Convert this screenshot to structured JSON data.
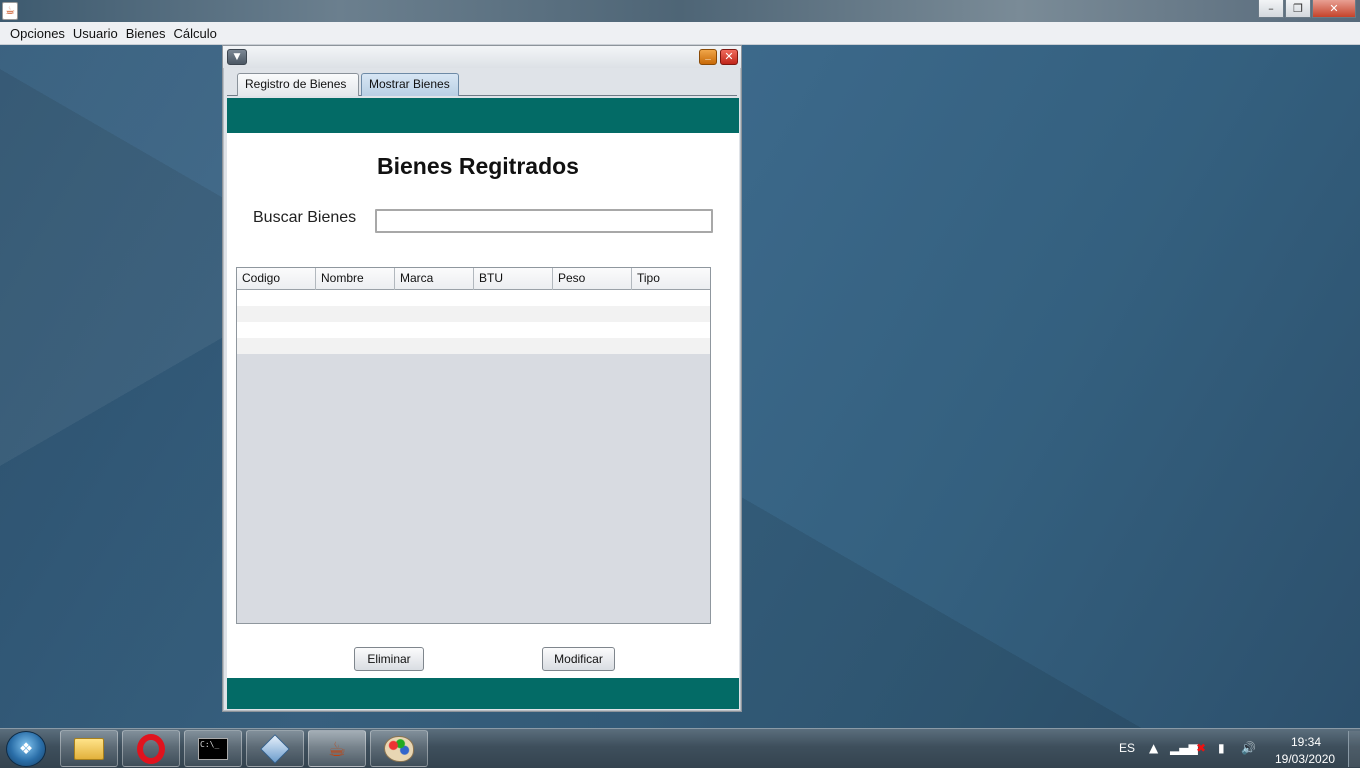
{
  "app": {
    "menu": [
      "Opciones",
      "Usuario",
      "Bienes",
      "Cálculo"
    ],
    "controls": {
      "minimize": "–",
      "maximize": "❐",
      "close": "✕"
    }
  },
  "internal_frame": {
    "tabs": [
      "Registro de Bienes",
      "Mostrar Bienes"
    ],
    "active_tab": "Mostrar Bienes",
    "heading": "Bienes Regitrados",
    "search": {
      "label": "Buscar Bienes",
      "value": ""
    },
    "table": {
      "columns": [
        "Codigo",
        "Nombre",
        "Marca",
        "BTU",
        "Peso",
        "Tipo"
      ],
      "rows": [
        [
          "",
          "",
          "",
          "",
          "",
          ""
        ],
        [
          "",
          "",
          "",
          "",
          "",
          ""
        ],
        [
          "",
          "",
          "",
          "",
          "",
          ""
        ],
        [
          "",
          "",
          "",
          "",
          "",
          ""
        ]
      ]
    },
    "buttons": {
      "eliminar": "Eliminar",
      "modificar": "Modificar"
    },
    "band_color": "#036b66"
  },
  "taskbar": {
    "apps": [
      "windows-explorer-icon",
      "opera-icon",
      "cmd-icon",
      "virtualbox-icon",
      "java-icon",
      "paint-icon"
    ],
    "tray": {
      "language": "ES",
      "time": "19:34",
      "date": "19/03/2020"
    }
  }
}
